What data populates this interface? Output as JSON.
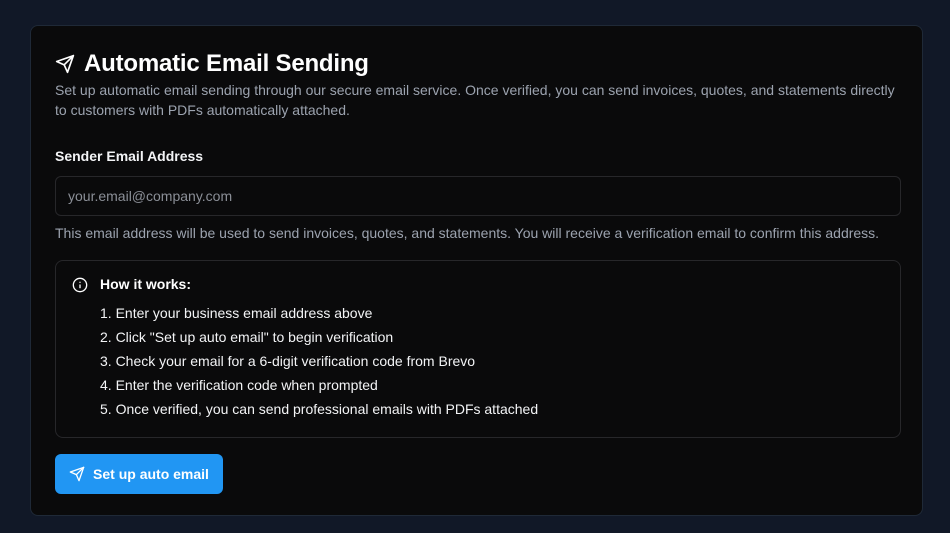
{
  "card": {
    "title": "Automatic Email Sending",
    "title_icon": "send-icon",
    "description": "Set up automatic email sending through our secure email service. Once verified, you can send invoices, quotes, and statements directly to customers with PDFs automatically attached."
  },
  "email_field": {
    "label": "Sender Email Address",
    "value": "",
    "placeholder": "your.email@company.com",
    "hint": "This email address will be used to send invoices, quotes, and statements. You will receive a verification email to confirm this address."
  },
  "info": {
    "icon": "info-icon",
    "title": "How it works:",
    "steps": [
      "1. Enter your business email address above",
      "2. Click \"Set up auto email\" to begin verification",
      "3. Check your email for a 6-digit verification code from Brevo",
      "4. Enter the verification code when prompted",
      "5. Once verified, you can send professional emails with PDFs attached"
    ]
  },
  "button": {
    "label": "Set up auto email",
    "icon": "send-icon"
  },
  "colors": {
    "background": "#111827",
    "card": "#0a0a0b",
    "border": "#27272a",
    "accent": "#2196f3",
    "muted_text": "#9ca3af"
  }
}
